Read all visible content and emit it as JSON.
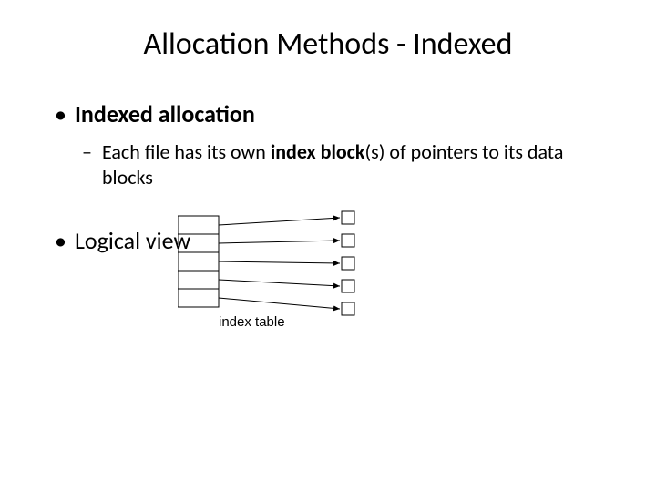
{
  "title": "Allocation Methods - Indexed",
  "bullet1": "Indexed allocation",
  "sub": {
    "prefix": "Each file has its own ",
    "bold": "index block",
    "suffix": "(s) of pointers to its data blocks"
  },
  "bullet2": "Logical view",
  "caption": "index table"
}
